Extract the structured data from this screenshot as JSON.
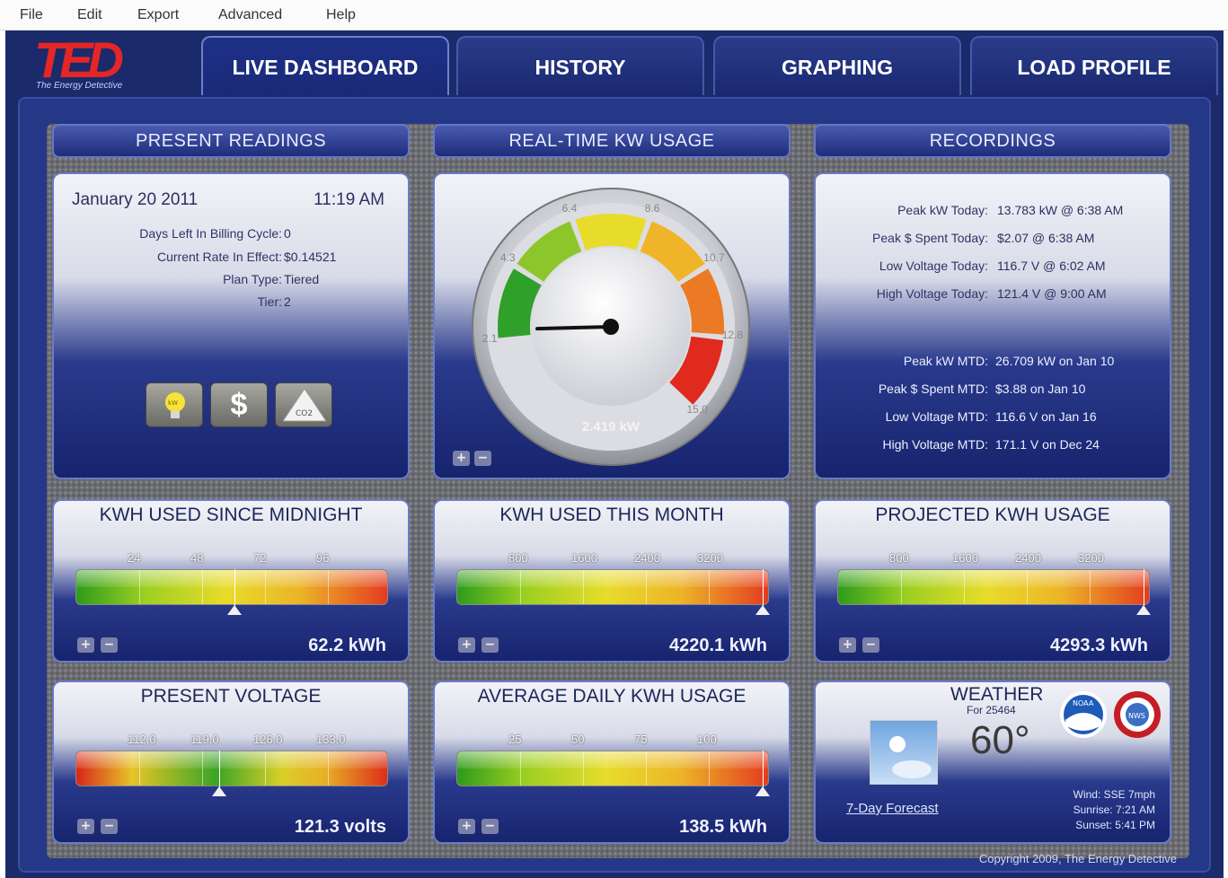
{
  "menu": [
    "File",
    "Edit",
    "Export",
    "Advanced",
    "Help"
  ],
  "logo": {
    "mark": "TED",
    "tagline": "The Energy Detective"
  },
  "tabs": [
    "LIVE DASHBOARD",
    "HISTORY",
    "GRAPHING",
    "LOAD PROFILE"
  ],
  "active_tab": "LIVE DASHBOARD",
  "headers": {
    "present": "PRESENT READINGS",
    "realtime": "REAL-TIME KW USAGE",
    "recordings": "RECORDINGS"
  },
  "present": {
    "date": "January 20 2011",
    "time": "11:19 AM",
    "rows": [
      {
        "label": "Days Left In Billing Cycle:",
        "value": "0"
      },
      {
        "label": "Current Rate In Effect:",
        "value": "$0.14521"
      },
      {
        "label": "Plan Type:",
        "value": "Tiered"
      },
      {
        "label": "Tier:",
        "value": "2"
      }
    ],
    "icons": [
      "kw-bulb-icon",
      "dollar-icon",
      "co2-icon"
    ],
    "dollar_glyph": "$",
    "co2_text": "CO2"
  },
  "gauge": {
    "ticks": [
      "2.1",
      "4.3",
      "6.4",
      "8.6",
      "10.7",
      "12.8",
      "15.0"
    ],
    "reading": "2.419 kW",
    "value": 2.419,
    "min": 0,
    "max": 15
  },
  "recordings": {
    "today": [
      {
        "label": "Peak kW Today:",
        "value": "13.783 kW @ 6:38 AM"
      },
      {
        "label": "Peak $ Spent Today:",
        "value": "$2.07 @ 6:38 AM"
      },
      {
        "label": "Low Voltage Today:",
        "value": "116.7 V @ 6:02 AM"
      },
      {
        "label": "High Voltage Today:",
        "value": "121.4 V @ 9:00 AM"
      }
    ],
    "mtd": [
      {
        "label": "Peak kW MTD:",
        "value": "26.709 kW on Jan 10"
      },
      {
        "label": "Peak $ Spent MTD:",
        "value": "$3.88 on Jan 10"
      },
      {
        "label": "Low Voltage MTD:",
        "value": "116.6 V on Jan 16"
      },
      {
        "label": "High Voltage MTD:",
        "value": "171.1 V on Dec 24"
      }
    ]
  },
  "meters": [
    {
      "title": "KWH USED SINCE MIDNIGHT",
      "ticks": [
        "24",
        "48",
        "72",
        "96"
      ],
      "value": "62.2 kWh",
      "fraction": 0.51,
      "style": "g2r"
    },
    {
      "title": "KWH USED THIS MONTH",
      "ticks": [
        "800",
        "1600",
        "2400",
        "3200"
      ],
      "value": "4220.1 kWh",
      "fraction": 0.98,
      "style": "g2r"
    },
    {
      "title": "PROJECTED KWH USAGE",
      "ticks": [
        "800",
        "1600",
        "2400",
        "3200"
      ],
      "value": "4293.3 kWh",
      "fraction": 0.98,
      "style": "g2r"
    },
    {
      "title": "PRESENT VOLTAGE",
      "ticks": [
        "112.0",
        "119.0",
        "126.0",
        "133.0"
      ],
      "value": "121.3 volts",
      "fraction": 0.46,
      "style": "r2g2r"
    },
    {
      "title": "AVERAGE DAILY KWH USAGE",
      "ticks": [
        "25",
        "50",
        "75",
        "100"
      ],
      "value": "138.5 kWh",
      "fraction": 0.98,
      "style": "g2r"
    }
  ],
  "weather": {
    "title": "WEATHER",
    "for": "For 25464",
    "temp": "60°",
    "forecast_link": "7-Day Forecast",
    "wind": "Wind: SSE 7mph",
    "sunrise": "Sunrise: 7:21 AM",
    "sunset": "Sunset: 5:41 PM",
    "logos": [
      "noaa-logo",
      "nws-logo"
    ],
    "noaa_text": "NOAA",
    "nws_text": "NWS"
  },
  "footer": "Copyright 2009, The Energy Detective",
  "colors": {
    "navy": "#1b2a6b",
    "logo_red": "#e52626",
    "danger": "#e43c20",
    "ok": "#2e9b1c"
  }
}
